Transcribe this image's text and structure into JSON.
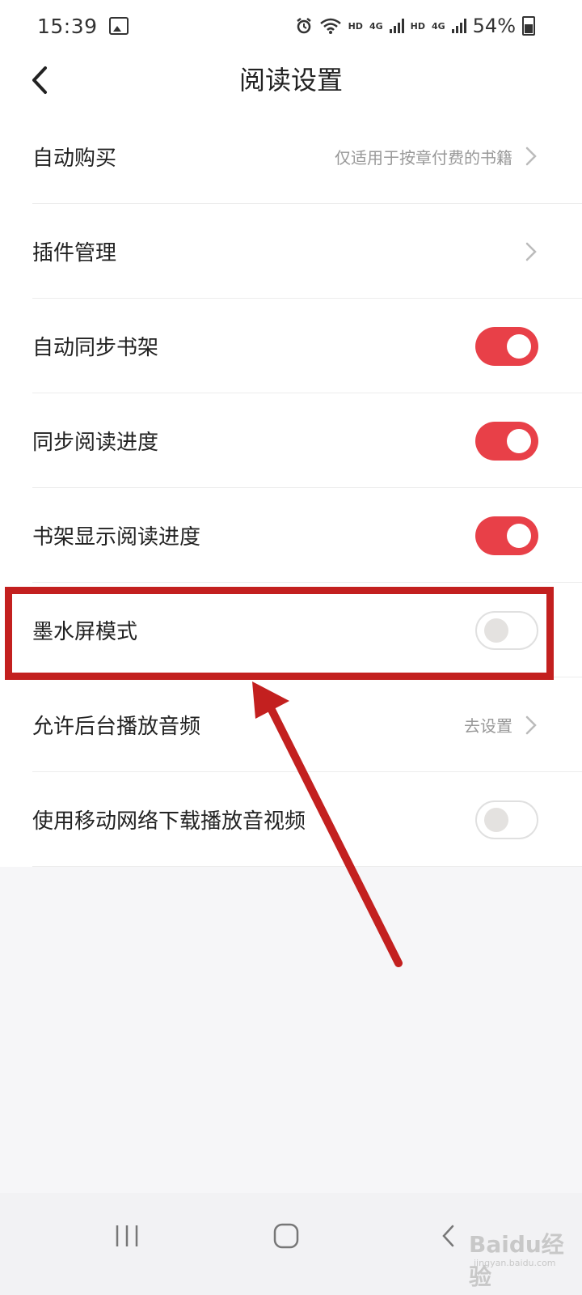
{
  "status_bar": {
    "time": "15:39",
    "hd_1": "HD",
    "net_1": "4G",
    "hd_2": "HD",
    "net_2": "4G",
    "battery_percent": "54%"
  },
  "header": {
    "title": "阅读设置"
  },
  "settings": [
    {
      "label": "自动购买",
      "hint": "仅适用于按章付费的书籍",
      "control": "chevron"
    },
    {
      "label": "插件管理",
      "hint": "",
      "control": "chevron"
    },
    {
      "label": "自动同步书架",
      "control": "toggle",
      "value": true
    },
    {
      "label": "同步阅读进度",
      "control": "toggle",
      "value": true
    },
    {
      "label": "书架显示阅读进度",
      "control": "toggle",
      "value": true
    },
    {
      "label": "墨水屏模式",
      "control": "toggle",
      "value": false
    },
    {
      "label": "允许后台播放音频",
      "hint": "去设置",
      "control": "chevron"
    },
    {
      "label": "使用移动网络下载播放音视频",
      "control": "toggle",
      "value": false
    }
  ],
  "watermark": {
    "text": "Baidu经验",
    "sub": "jingyan.baidu.com"
  },
  "colors": {
    "accent": "#e84048",
    "highlight": "#c3201f",
    "background": "#f6f6f8"
  },
  "icons": {
    "back": "chevron-left-icon",
    "row_arrow": "chevron-right-icon",
    "recents": "recents-icon",
    "home": "home-icon",
    "system_back": "back-icon"
  }
}
